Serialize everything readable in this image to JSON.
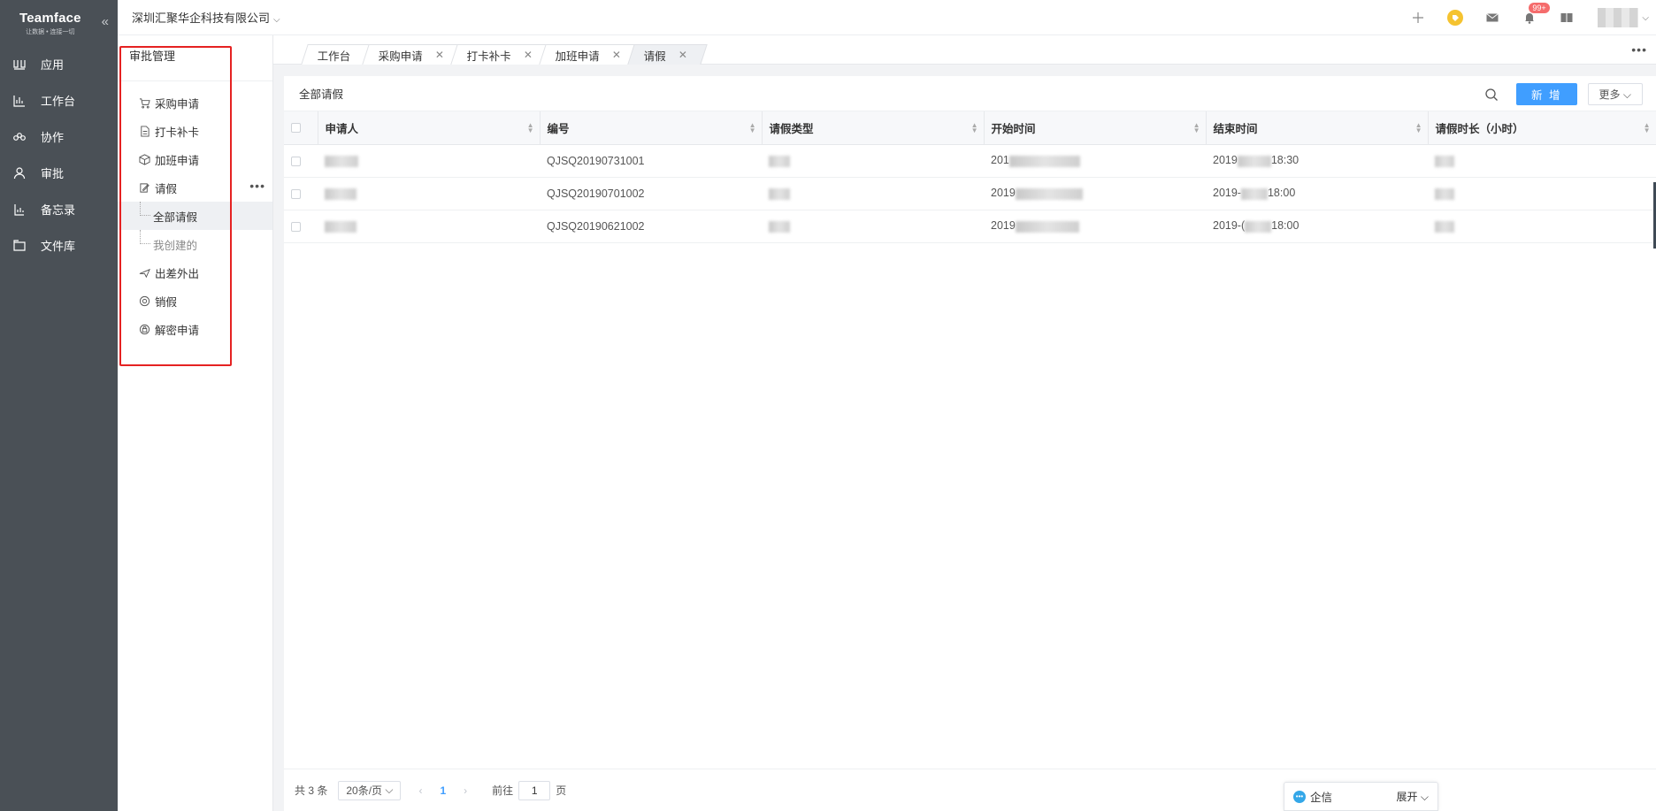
{
  "brand": {
    "name": "Teamface",
    "tagline": "让数据 • 连接一切"
  },
  "nav": [
    {
      "label": "应用",
      "icon": "apps-icon"
    },
    {
      "label": "工作台",
      "icon": "chart-icon"
    },
    {
      "label": "协作",
      "icon": "team-icon"
    },
    {
      "label": "审批",
      "icon": "person-icon"
    },
    {
      "label": "备忘录",
      "icon": "memo-icon"
    },
    {
      "label": "文件库",
      "icon": "folder-icon"
    }
  ],
  "header": {
    "company": "深圳汇聚华企科技有限公司",
    "notification_badge": "99+"
  },
  "subnav": {
    "title": "审批管理",
    "items": [
      {
        "label": "采购申请"
      },
      {
        "label": "打卡补卡"
      },
      {
        "label": "加班申请"
      },
      {
        "label": "请假"
      }
    ],
    "children": [
      {
        "label": "全部请假"
      },
      {
        "label": "我创建的"
      }
    ],
    "items_after": [
      {
        "label": "出差外出"
      },
      {
        "label": "销假"
      },
      {
        "label": "解密申请"
      }
    ]
  },
  "tabs": [
    {
      "label": "工作台"
    },
    {
      "label": "采购申请"
    },
    {
      "label": "打卡补卡"
    },
    {
      "label": "加班申请"
    },
    {
      "label": "请假"
    }
  ],
  "main": {
    "title": "全部请假",
    "new_button": "新 增",
    "more_button": "更多",
    "columns": [
      "申请人",
      "编号",
      "请假类型",
      "开始时间",
      "结束时间",
      "请假时长（小时）"
    ],
    "rows": [
      {
        "applicant": "",
        "code": "QJSQ20190731001",
        "type": "",
        "start": "201",
        "end_prefix": "2019",
        "end_suffix": "18:30",
        "hours": ""
      },
      {
        "applicant": "",
        "code": "QJSQ20190701002",
        "type": "",
        "start": "2019",
        "end_prefix": "2019-",
        "end_suffix": "18:00",
        "hours": ""
      },
      {
        "applicant": "",
        "code": "QJSQ20190621002",
        "type": "",
        "start": "2019",
        "end_prefix": "2019-(",
        "end_suffix": "18:00",
        "hours": ""
      }
    ]
  },
  "pager": {
    "total": "共 3 条",
    "page_size": "20条/页",
    "current_page": "1",
    "goto_label": "前往",
    "goto_value": "1",
    "page_unit": "页"
  },
  "chat": {
    "label": "企信",
    "expand": "展开"
  },
  "colors": {
    "nav_bg": "#4a5056",
    "accent": "#409eff",
    "highlight": "#e52222",
    "badge": "#f56c6c"
  }
}
